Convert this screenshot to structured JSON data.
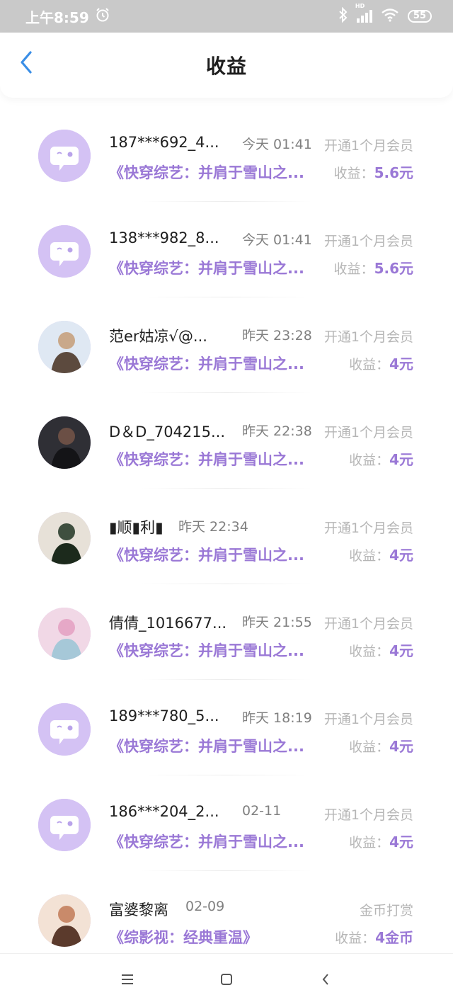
{
  "status_bar": {
    "time": "上午8:59",
    "battery": "55",
    "hd_label": "HD"
  },
  "header": {
    "title": "收益"
  },
  "earn_prefix": "收益：",
  "rows": [
    {
      "name": "187***692_4...",
      "time": "今天 01:41",
      "action": "开通1个月会员",
      "book": "《快穿综艺：并肩于雪山之...",
      "earning": "5.6元",
      "avatar": "default-avatar"
    },
    {
      "name": "138***982_8...",
      "time": "今天 01:41",
      "action": "开通1个月会员",
      "book": "《快穿综艺：并肩于雪山之...",
      "earning": "5.6元",
      "avatar": "default-avatar"
    },
    {
      "name": "范er姑凉√@...",
      "time": "昨天 23:28",
      "action": "开通1个月会员",
      "book": "《快穿综艺：并肩于雪山之...",
      "earning": "4元",
      "avatar": "photo-avatar"
    },
    {
      "name": "D＆D_704215...",
      "time": "昨天 22:38",
      "action": "开通1个月会员",
      "book": "《快穿综艺：并肩于雪山之...",
      "earning": "4元",
      "avatar": "photo-avatar"
    },
    {
      "name": "▮顺▮利▮",
      "time": "昨天 22:34",
      "action": "开通1个月会员",
      "book": "《快穿综艺：并肩于雪山之...",
      "earning": "4元",
      "avatar": "photo-avatar"
    },
    {
      "name": "倩倩_1016677...",
      "time": "昨天 21:55",
      "action": "开通1个月会员",
      "book": "《快穿综艺：并肩于雪山之...",
      "earning": "4元",
      "avatar": "photo-avatar"
    },
    {
      "name": "189***780_5...",
      "time": "昨天 18:19",
      "action": "开通1个月会员",
      "book": "《快穿综艺：并肩于雪山之...",
      "earning": "4元",
      "avatar": "default-avatar"
    },
    {
      "name": "186***204_2...",
      "time": "02-11",
      "action": "开通1个月会员",
      "book": "《快穿综艺：并肩于雪山之...",
      "earning": "4元",
      "avatar": "default-avatar"
    },
    {
      "name": "富婆黎离",
      "time": "02-09",
      "action": "金币打赏",
      "book": "《综影视：经典重温》",
      "earning": "4金币",
      "avatar": "photo-avatar"
    }
  ],
  "icons": {
    "back": "chevron-left-icon",
    "menu": "menu-icon",
    "home": "square-icon",
    "nav_back": "chevron-left-icon"
  },
  "colors": {
    "accent": "#9a78d6",
    "back_arrow": "#3a8ee6",
    "avatar_bg": "#d4c2f4"
  }
}
